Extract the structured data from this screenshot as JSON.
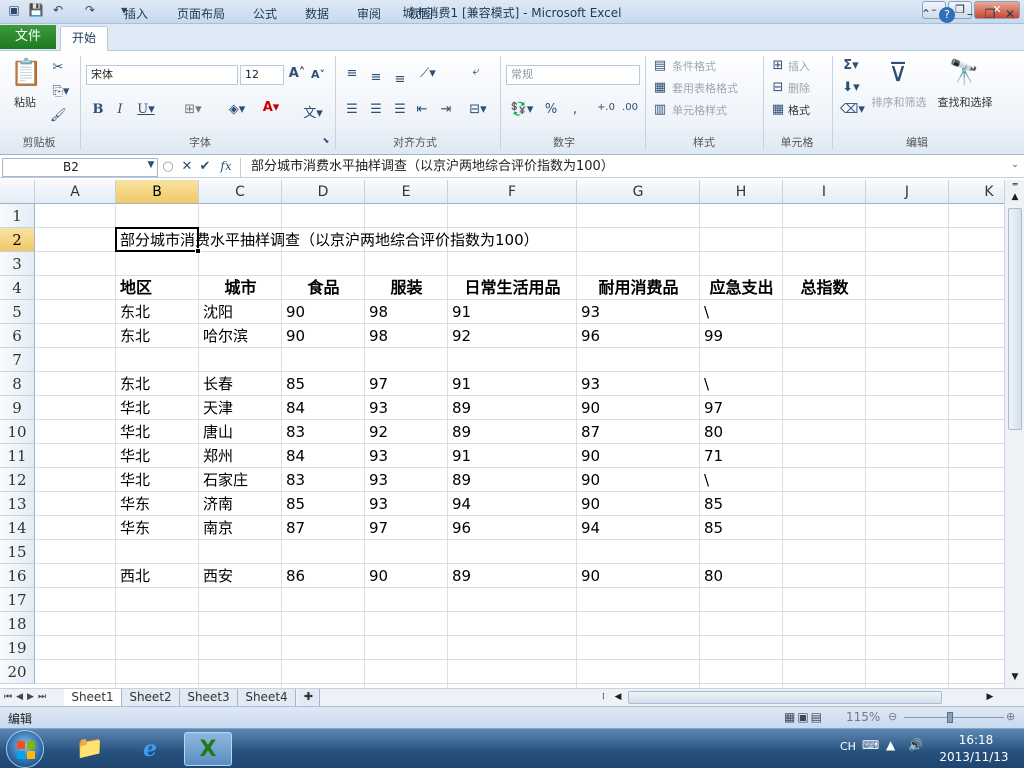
{
  "window": {
    "title": "城市消费1 [兼容模式] - Microsoft Excel"
  },
  "tabs": {
    "file": "文件",
    "home": "开始",
    "insert": "插入",
    "layout": "页面布局",
    "formulas": "公式",
    "data": "数据",
    "review": "审阅",
    "view": "视图"
  },
  "ribbon": {
    "clipboard": {
      "label": "剪贴板",
      "paste": "粘贴"
    },
    "font": {
      "label": "字体",
      "name": "宋体",
      "size": "12"
    },
    "align": {
      "label": "对齐方式"
    },
    "number": {
      "label": "数字",
      "format": "常规"
    },
    "styles": {
      "label": "样式",
      "cond": "条件格式",
      "table": "套用表格格式",
      "cellstyle": "单元格样式"
    },
    "cells": {
      "label": "单元格",
      "insert": "插入",
      "delete": "删除",
      "format": "格式"
    },
    "editing": {
      "label": "编辑",
      "sort": "排序和筛选",
      "find": "查找和选择"
    }
  },
  "formula_bar": {
    "name_box": "B2",
    "fx": "fx",
    "content": "部分城市消费水平抽样调查（以京沪两地综合评价指数为100）"
  },
  "columns": [
    "A",
    "B",
    "C",
    "D",
    "E",
    "F",
    "G",
    "H",
    "I",
    "J",
    "K"
  ],
  "rows": [
    "1",
    "2",
    "3",
    "4",
    "5",
    "6",
    "7",
    "8",
    "9",
    "10",
    "11",
    "12",
    "13",
    "14",
    "15",
    "16",
    "17",
    "18",
    "19",
    "20"
  ],
  "sheet": {
    "title": "部分城市消费水平抽样调查（以京沪两地综合评价指数为100）",
    "headers": [
      "地区",
      "城市",
      "食品",
      "服装",
      "日常生活用品",
      "耐用消费品",
      "应急支出",
      "总指数"
    ],
    "data": [
      {
        "row": 5,
        "cells": [
          "东北",
          "沈阳",
          "90",
          "98",
          "91",
          "93",
          "\\"
        ]
      },
      {
        "row": 6,
        "cells": [
          "东北",
          "哈尔滨",
          "90",
          "98",
          "92",
          "96",
          "99"
        ]
      },
      {
        "row": 8,
        "cells": [
          "东北",
          "长春",
          "85",
          "97",
          "91",
          "93",
          "\\"
        ]
      },
      {
        "row": 9,
        "cells": [
          "华北",
          "天津",
          "84",
          "93",
          "89",
          "90",
          "97"
        ]
      },
      {
        "row": 10,
        "cells": [
          "华北",
          "唐山",
          "83",
          "92",
          "89",
          "87",
          "80"
        ]
      },
      {
        "row": 11,
        "cells": [
          "华北",
          "郑州",
          "84",
          "93",
          "91",
          "90",
          "71"
        ]
      },
      {
        "row": 12,
        "cells": [
          "华北",
          "石家庄",
          "83",
          "93",
          "89",
          "90",
          "\\"
        ]
      },
      {
        "row": 13,
        "cells": [
          "华东",
          "济南",
          "85",
          "93",
          "94",
          "90",
          "85"
        ]
      },
      {
        "row": 14,
        "cells": [
          "华东",
          "南京",
          "87",
          "97",
          "96",
          "94",
          "85"
        ]
      },
      {
        "row": 16,
        "cells": [
          "西北",
          "西安",
          "86",
          "90",
          "89",
          "90",
          "80"
        ]
      }
    ]
  },
  "sheet_tabs": [
    "Sheet1",
    "Sheet2",
    "Sheet3",
    "Sheet4"
  ],
  "status": {
    "mode": "编辑",
    "zoom": "115%"
  },
  "taskbar": {
    "lang": "CH",
    "time": "16:18",
    "date": "2013/11/13"
  },
  "colors": {
    "accent": "#1e7a1e",
    "selection": "#f2c867"
  }
}
